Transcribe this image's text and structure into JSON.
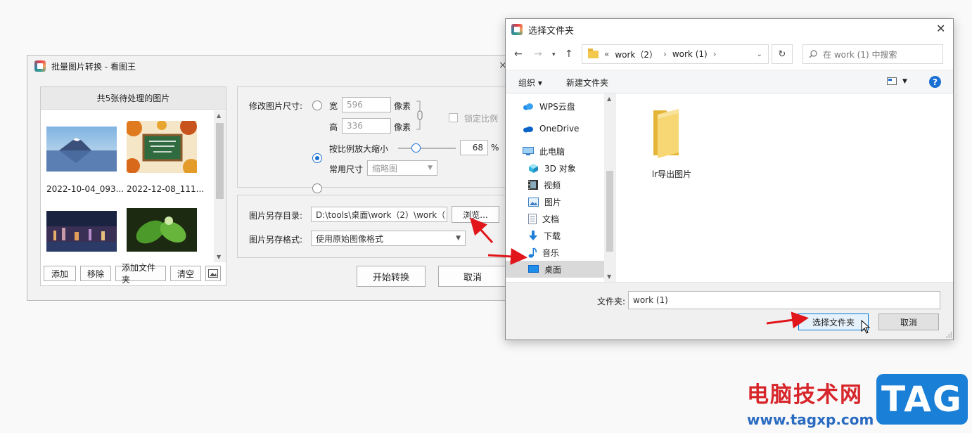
{
  "main_window": {
    "title": "批量图片转换 - 看图王",
    "close_glyph": "×",
    "thumbs_header": "共5张待处理的图片",
    "thumbnails": [
      {
        "caption": "2022-10-04_093..."
      },
      {
        "caption": "2022-12-08_111..."
      },
      {
        "caption": ""
      },
      {
        "caption": ""
      }
    ],
    "thumb_buttons": {
      "add": "添加",
      "remove": "移除",
      "add_folder": "添加文件夹",
      "clear": "清空"
    },
    "resize": {
      "label": "修改图片尺寸:",
      "width_label": "宽",
      "width_value": "596",
      "width_unit": "像素",
      "height_label": "高",
      "height_value": "336",
      "height_unit": "像素",
      "lock_label": "锁定比例",
      "scale_label": "按比例放大缩小",
      "scale_value": "68",
      "scale_unit": "%",
      "scale_fraction": 0.3,
      "preset_label": "常用尺寸",
      "preset_value": "缩略图"
    },
    "save": {
      "dir_label": "图片另存目录:",
      "dir_value": "D:\\tools\\桌面\\work（2）\\work（",
      "browse_label": "浏览...",
      "format_label": "图片另存格式:",
      "format_value": "使用原始图像格式"
    },
    "start_label": "开始转换",
    "cancel_label": "取消"
  },
  "dialog": {
    "title": "选择文件夹",
    "close_glyph": "✕",
    "breadcrumb": [
      "«",
      "work（2）",
      "›",
      "work (1)",
      "›"
    ],
    "search_placeholder": "在 work (1) 中搜索",
    "toolbar": {
      "organize": "组织 ▾",
      "new_folder": "新建文件夹",
      "help": "?"
    },
    "nav_items": [
      {
        "label": "WPS云盘",
        "icon": "cloud-icon"
      },
      {
        "label": "OneDrive",
        "icon": "onedrive-icon"
      },
      {
        "label": "此电脑",
        "icon": "computer-icon"
      },
      {
        "label": "3D 对象",
        "icon": "cube-icon"
      },
      {
        "label": "视频",
        "icon": "video-icon"
      },
      {
        "label": "图片",
        "icon": "picture-icon"
      },
      {
        "label": "文档",
        "icon": "document-icon"
      },
      {
        "label": "下载",
        "icon": "download-icon"
      },
      {
        "label": "音乐",
        "icon": "music-icon"
      },
      {
        "label": "桌面",
        "icon": "desktop-icon"
      }
    ],
    "selected_nav": "桌面",
    "folder_item": "lr导出图片",
    "folder_field_label": "文件夹:",
    "folder_field_value": "work (1)",
    "select_button": "选择文件夹",
    "cancel_button": "取消"
  },
  "watermark": {
    "text": "电脑技术网",
    "url": "www.tagxp.com",
    "badge": "TAG"
  },
  "colors": {
    "accent": "#1a6fd3",
    "arrow": "#e0161b",
    "watermark_red": "#d7262b",
    "watermark_blue": "#1a7fd6"
  }
}
